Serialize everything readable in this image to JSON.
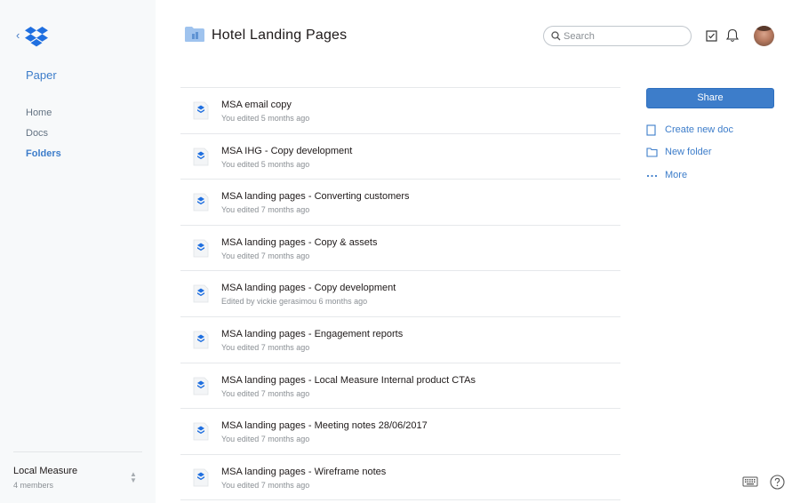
{
  "sidebar": {
    "app_name": "Paper",
    "nav": [
      "Home",
      "Docs",
      "Folders"
    ],
    "active_nav": "Folders",
    "team": {
      "name": "Local Measure",
      "members": "4 members"
    }
  },
  "header": {
    "title": "Hotel Landing Pages",
    "search_placeholder": "Search"
  },
  "documents": [
    {
      "title": "MSA email copy",
      "meta": "You edited 5 months ago"
    },
    {
      "title": "MSA IHG - Copy development",
      "meta": "You edited 5 months ago"
    },
    {
      "title": "MSA landing pages - Converting customers",
      "meta": "You edited 7 months ago"
    },
    {
      "title": "MSA landing pages - Copy & assets",
      "meta": "You edited 7 months ago"
    },
    {
      "title": "MSA landing pages - Copy development",
      "meta": "Edited by vickie gerasimou 6 months ago"
    },
    {
      "title": "MSA landing pages - Engagement reports",
      "meta": "You edited 7 months ago"
    },
    {
      "title": "MSA landing pages - Local Measure Internal product CTAs",
      "meta": "You edited 7 months ago"
    },
    {
      "title": "MSA landing pages - Meeting notes 28/06/2017",
      "meta": "You edited 7 months ago"
    },
    {
      "title": "MSA landing pages - Wireframe notes",
      "meta": "You edited 7 months ago"
    }
  ],
  "actions": {
    "share": "Share",
    "create_doc": "Create new doc",
    "new_folder": "New folder",
    "more": "More"
  },
  "colors": {
    "accent": "#3d7dca",
    "sidebar_bg": "#f7f9fa",
    "folder": "#9fc3ee",
    "doc_icon": "#1f6fe0"
  },
  "icons": {
    "logo": "dropbox-logo",
    "back": "chevron-left-icon",
    "folder": "folder-icon",
    "search": "search-icon",
    "checklist": "checklist-icon",
    "bell": "bell-icon",
    "doc": "paper-doc-icon",
    "keyboard": "keyboard-icon",
    "help": "help-icon"
  }
}
